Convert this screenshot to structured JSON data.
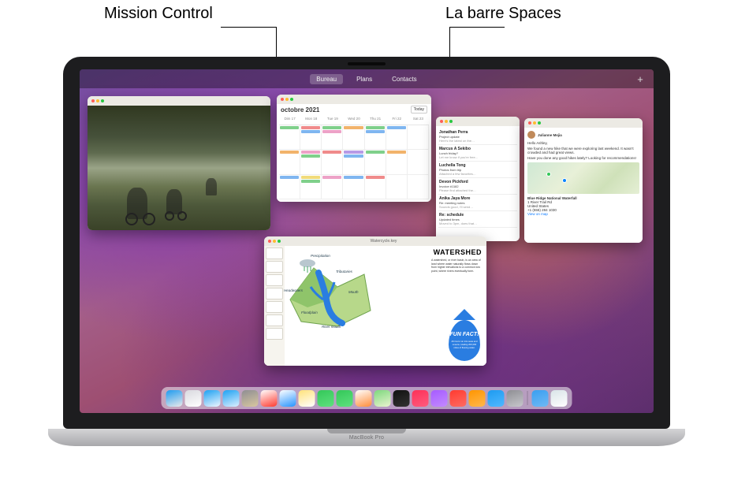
{
  "callouts": {
    "left": "Mission Control",
    "right": "La barre Spaces"
  },
  "spaces": {
    "items": [
      "Bureau",
      "Plans",
      "Contacts"
    ],
    "add_label": "+"
  },
  "calendar": {
    "month": "octobre 2021",
    "today_label": "Today",
    "days": [
      "Dim 17",
      "Mon 18",
      "Tue 19",
      "Wed 20",
      "Thu 21",
      "Fri 22",
      "Sat 23"
    ]
  },
  "mail_list": {
    "items": [
      {
        "sender": "Jonathan Perra",
        "subject": "Project update",
        "preview": "Here's the latest on the…"
      },
      {
        "sender": "Marcus A Sekibo",
        "subject": "Lunch friday?",
        "preview": "Let me know if you're free…"
      },
      {
        "sender": "Luchella Tong",
        "subject": "Photos from trip",
        "preview": "Attached a few favorites…"
      },
      {
        "sender": "Devon Pickford",
        "subject": "Invoice #1182",
        "preview": "Please find attached the…"
      },
      {
        "sender": "Anika Jaya More",
        "subject": "Re: meeting notes",
        "preview": "Sounds good, I'll send…"
      },
      {
        "sender": "Re: schedule",
        "subject": "Updated times",
        "preview": "Moved to 3pm, does that…"
      }
    ]
  },
  "mail_view": {
    "sender": "Julianne Mejia",
    "greeting": "Hello Ashley,",
    "line1": "We found a new hike that we were exploring last weekend. It wasn't crowded and had great views.",
    "line2": "Have you done any good hikes lately? Looking for recommendations!",
    "place": "Blue Ridge National Waterfall",
    "addr1": "1 River Trail Rd",
    "addr2": "United States",
    "phone": "+1 (555) 284 1030",
    "link": "View on map"
  },
  "keynote": {
    "doc_title": "Watercycle.key",
    "heading": "WATERSHED",
    "body": "A watershed, or river basin, is an area of land where water naturally flows down from higher elevations to a common low point, where rivers eventually form.",
    "labels": {
      "precipitation": "Precipitation",
      "tributaries": "Tributaries",
      "headwaters": "Headwaters",
      "floodplain": "Floodplain",
      "mouth": "Mouth",
      "river_mouth": "River mouth"
    },
    "funfact_title": "FUN FACT!",
    "funfact_body": "All rivers run into seas and oceans, totaling 200,000 miles of flowing water."
  },
  "dock": {
    "apps": [
      {
        "name": "finder",
        "c1": "#1e9bf0",
        "c2": "#eaeaea"
      },
      {
        "name": "launchpad",
        "c1": "#d9d9df",
        "c2": "#ffffff"
      },
      {
        "name": "safari",
        "c1": "#1da1f2",
        "c2": "#eef6ff"
      },
      {
        "name": "mail",
        "c1": "#1da1f2",
        "c2": "#dcefff"
      },
      {
        "name": "contacts",
        "c1": "#8e8e93",
        "c2": "#d8c7a0"
      },
      {
        "name": "calendar",
        "c1": "#ffffff",
        "c2": "#ff3b30"
      },
      {
        "name": "reminders",
        "c1": "#ffffff",
        "c2": "#2593ff"
      },
      {
        "name": "notes",
        "c1": "#ffe27a",
        "c2": "#ffffff"
      },
      {
        "name": "messages",
        "c1": "#34c759",
        "c2": "#5ee17e"
      },
      {
        "name": "facetime",
        "c1": "#34c759",
        "c2": "#5ee17e"
      },
      {
        "name": "photos",
        "c1": "#ffffff",
        "c2": "#ff8d3a"
      },
      {
        "name": "maps",
        "c1": "#7dd87d",
        "c2": "#e9f4cf"
      },
      {
        "name": "tv",
        "c1": "#111111",
        "c2": "#333333"
      },
      {
        "name": "music",
        "c1": "#fc3158",
        "c2": "#ff5b7e"
      },
      {
        "name": "podcasts",
        "c1": "#a65cff",
        "c2": "#c389ff"
      },
      {
        "name": "news",
        "c1": "#ff3b30",
        "c2": "#ff6b63"
      },
      {
        "name": "books",
        "c1": "#ff9500",
        "c2": "#ffb84d"
      },
      {
        "name": "appstore",
        "c1": "#1e9bf0",
        "c2": "#4fb8ff"
      },
      {
        "name": "settings",
        "c1": "#8e8e93",
        "c2": "#c7c7cc"
      }
    ],
    "right": [
      {
        "name": "downloads",
        "c1": "#3a9ff0",
        "c2": "#6fb9f5"
      },
      {
        "name": "trash",
        "c1": "#d9e4e8",
        "c2": "#ffffff"
      }
    ]
  },
  "laptop": {
    "brand": "MacBook Pro"
  },
  "palette": {
    "ev_green": "#7fd08b",
    "ev_blue": "#7fb6f0",
    "ev_orange": "#f2b36b",
    "ev_pink": "#eda2c7",
    "ev_red": "#f08b8b",
    "ev_purple": "#b79ae6",
    "ev_yellow": "#f1db7a"
  }
}
